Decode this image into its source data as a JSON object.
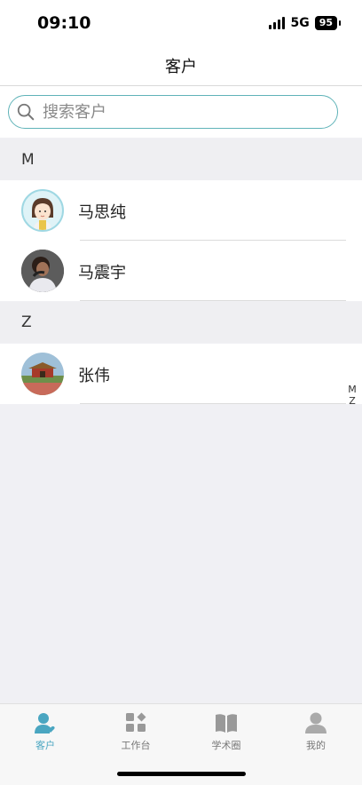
{
  "status_bar": {
    "time": "09:10",
    "network": "5G",
    "battery": "95"
  },
  "nav": {
    "title": "客户"
  },
  "search": {
    "placeholder": "搜索客户"
  },
  "sections": [
    {
      "letter": "M",
      "contacts": [
        {
          "name": "马思纯",
          "avatar": "cartoon-girl-avatar"
        },
        {
          "name": "马震宇",
          "avatar": "photo-person-avatar"
        }
      ]
    },
    {
      "letter": "Z",
      "contacts": [
        {
          "name": "张伟",
          "avatar": "landmark-photo-avatar"
        }
      ]
    }
  ],
  "index_letters": [
    "M",
    "Z"
  ],
  "tabs": [
    {
      "label": "客户",
      "icon": "customer-icon",
      "active": true
    },
    {
      "label": "工作台",
      "icon": "workbench-icon",
      "active": false
    },
    {
      "label": "学术圈",
      "icon": "book-icon",
      "active": false
    },
    {
      "label": "我的",
      "icon": "profile-icon",
      "active": false
    }
  ],
  "colors": {
    "accent": "#4aa6c1",
    "search_border": "#5fb3b8",
    "section_bg": "#efeff2"
  }
}
